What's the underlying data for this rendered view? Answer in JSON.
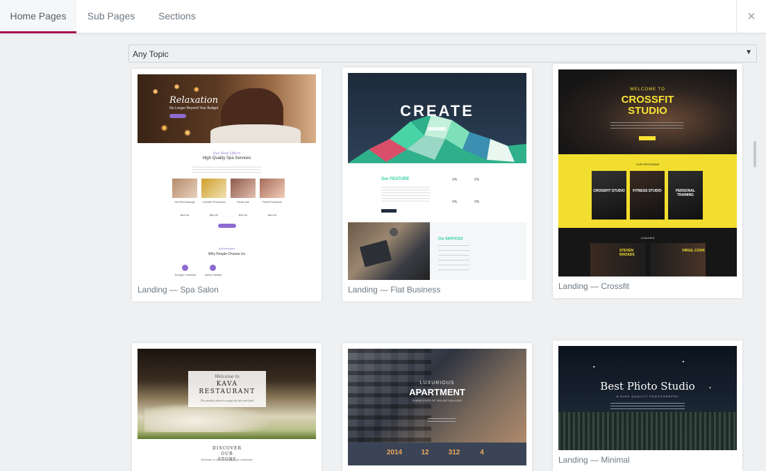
{
  "tabs": [
    {
      "label": "Home Pages"
    },
    {
      "label": "Sub Pages"
    },
    {
      "label": "Sections"
    }
  ],
  "close_icon": "×",
  "filter": {
    "selected": "Any Topic",
    "arrow": "▼"
  },
  "cards": [
    {
      "caption": "Landing — Spa Salon"
    },
    {
      "caption": "Landing — Flat Business"
    },
    {
      "caption": "Landing — Crossfit"
    },
    {
      "caption": ""
    },
    {
      "caption": ""
    },
    {
      "caption": "Landing — Minimal"
    }
  ],
  "spa": {
    "hero_title": "Relaxation",
    "hero_sub": "No Longer Beyond Your Budget",
    "section_kicker": "Our Best Offers",
    "section_title": "High Quality Spa Services",
    "services": [
      {
        "name": "Hot Oiled Massage",
        "price": "$49.00"
      },
      {
        "name": "Cosmetic Procedures",
        "price": "$59.00"
      },
      {
        "name": "Facial Care",
        "price": "$39.00"
      },
      {
        "name": "Facial Procedures",
        "price": "$49.00"
      }
    ],
    "why_kicker": "Advantages",
    "why_title": "Why People Choose Us",
    "features": [
      "Ecologic Cosmetics",
      "Author Lifestyle"
    ]
  },
  "flat": {
    "hero_title": "CREATE",
    "feature_title": "Our FEATURE",
    "stats": [
      "0%",
      "0%",
      "0%",
      "0%"
    ],
    "services_title": "Our SERVICES"
  },
  "crossfit": {
    "kicker": "WELCOME TO",
    "title": "CROSSFIT STUDIO",
    "programs_label": "OUR PROGRAMS",
    "programs": [
      "CROSSFIT STUDIO",
      "FITNESS STUDIO",
      "PERSONAL TRAINING"
    ],
    "coaches_label": "COACHES",
    "coaches": [
      "STEVEN RHOADS",
      "VIRGIL COOK"
    ]
  },
  "kava": {
    "welcome": "Welcome to",
    "title": "KAVA RESTAURANT",
    "tagline": "The perfect place to enjoy the life and food",
    "story": "DISCOVER OUR STORY",
    "story_sub": "Welcome to our Kava company restaurant"
  },
  "apartment": {
    "kicker": "LUXURIOUS",
    "title": "APARTMENT",
    "sub": "A NEW STATE OF THE ART BUILDING",
    "stats": [
      "2014",
      "12",
      "312",
      "4"
    ]
  },
  "minimal": {
    "title": "Best Photo Studio",
    "sub": "A HIGH QUALITY PHOTOGRAPHY"
  },
  "colors": {
    "accent": "#a4124f",
    "crossfit_yellow": "#f7e234",
    "flat_green": "#2fd0a3"
  }
}
